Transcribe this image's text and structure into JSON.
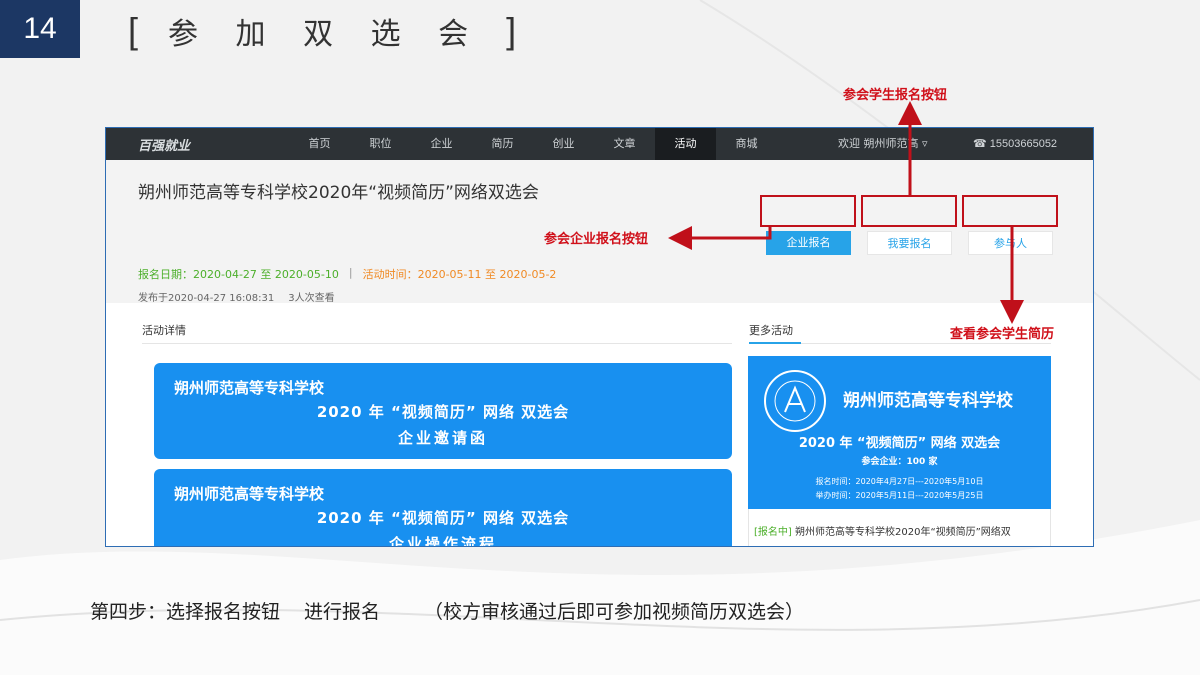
{
  "slide": {
    "number": "14",
    "title_open": "[",
    "title": "参 加 双 选 会",
    "title_close": "]"
  },
  "site": {
    "logo": "百强就业",
    "nav": [
      "首页",
      "职位",
      "企业",
      "简历",
      "创业",
      "文章",
      "活动",
      "商城"
    ],
    "active_nav": "活动",
    "welcome": "欢迎  朔州师范高 ▿",
    "phone": "☎ 15503665052"
  },
  "activity": {
    "title": "朔州师范高等专科学校2020年“视频简历”网络双选会",
    "buttons": {
      "company_signup": "企业报名",
      "student_signup": "我要报名",
      "participants": "参与人"
    },
    "reg_date": "报名日期：2020-04-27 至 2020-05-10",
    "separator": "|",
    "act_time": "活动时间：2020-05-11 至 2020-05-2",
    "published": "发布于2020-04-27 16:08:31",
    "views": "3人次查看"
  },
  "details": {
    "tab": "活动详情",
    "cards": [
      {
        "line1": "朔州师范高等专科学校",
        "line2": "2020 年 “视频简历” 网络 双选会",
        "line3": "企业邀请函"
      },
      {
        "line1": "朔州师范高等专科学校",
        "line2": "2020 年 “视频简历” 网络 双选会",
        "line3": "企业操作流程"
      }
    ]
  },
  "sidebar": {
    "title": "更多活动",
    "poster": {
      "school": "朔州师范高等专科学校",
      "event": "2020 年 “视频简历” 网络 双选会",
      "companies": "参会企业：100 家",
      "reg_time": "报名时间：2020年4月27日---2020年5月10日",
      "hold_time": "举办时间：2020年5月11日---2020年5月25日"
    },
    "news_tag": "[报名中]",
    "news_text": "朔州师范高等专科学校2020年“视频简历”网络双"
  },
  "annotations": {
    "student_signup": "参会学生报名按钮",
    "company_signup": "参会企业报名按钮",
    "view_resumes": "查看参会学生简历",
    "accent": "#d0101a"
  },
  "caption": {
    "step": "第四步：选择报名按钮",
    "action": "进行报名",
    "note": "（校方审核通过后即可参加视频简历双选会）"
  }
}
